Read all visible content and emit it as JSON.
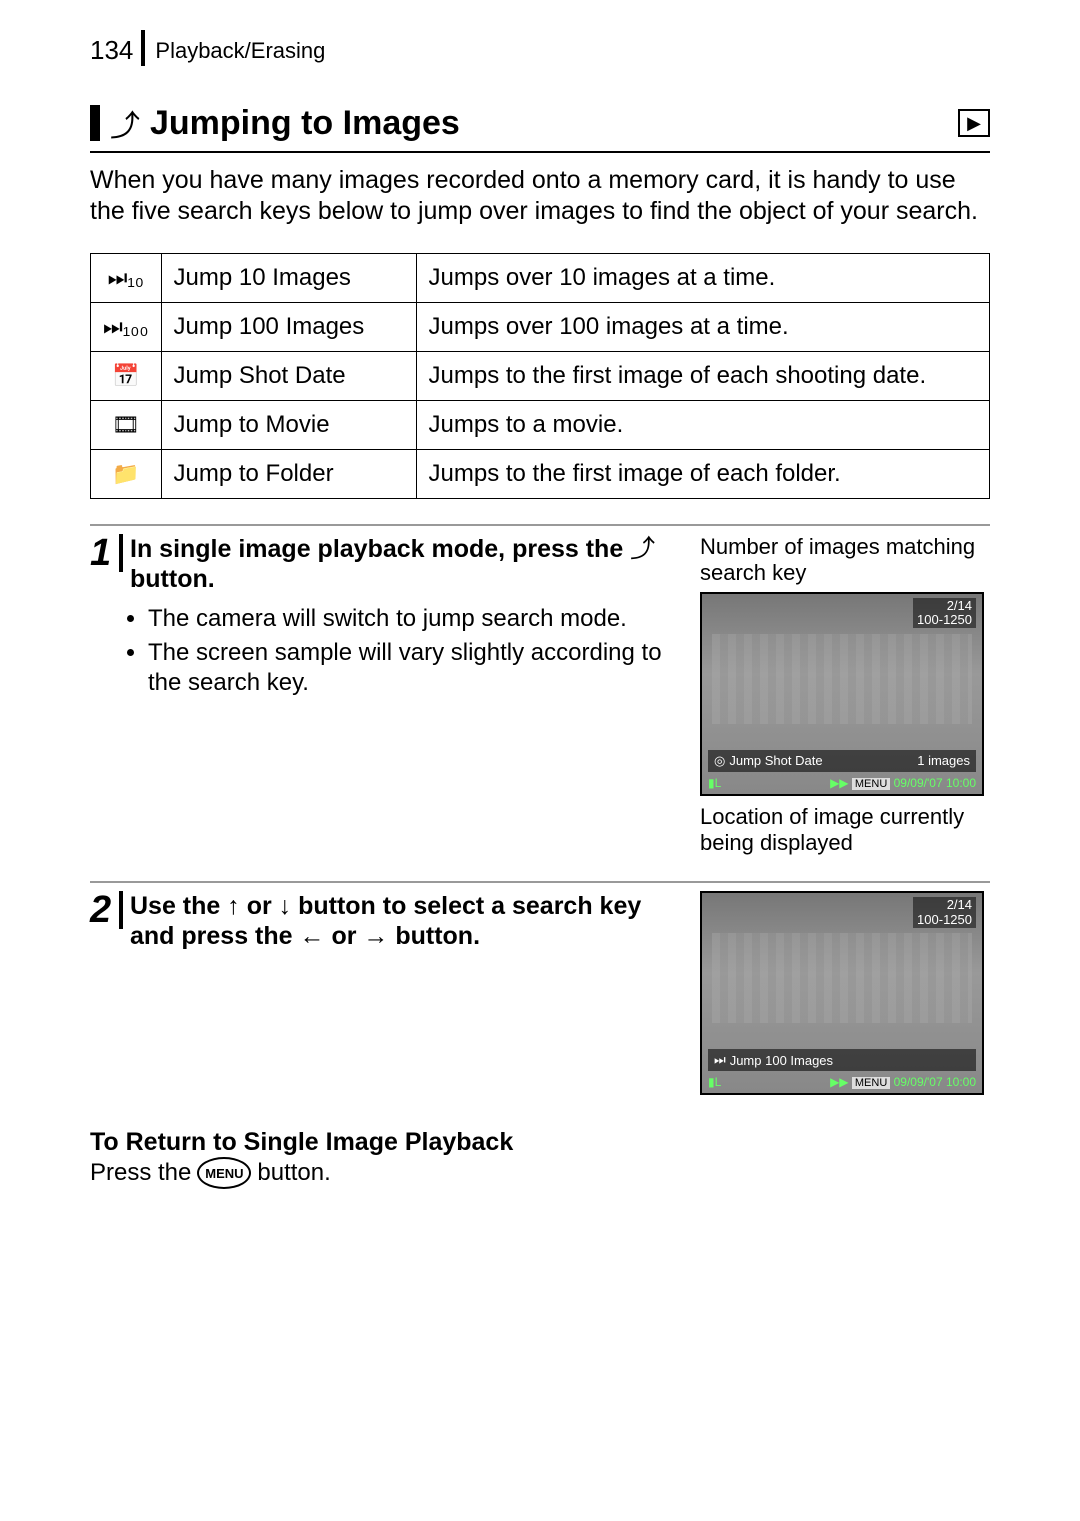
{
  "page_number": "134",
  "section": "Playback/Erasing",
  "title": "Jumping to Images",
  "intro": "When you have many images recorded onto a memory card, it is handy to use the five search keys below to jump over images to find the object of your search.",
  "table": [
    {
      "icon": "⏭₁₀",
      "label": "Jump 10 Images",
      "desc": "Jumps over 10 images at a time."
    },
    {
      "icon": "⏭₁₀₀",
      "label": "Jump 100 Images",
      "desc": "Jumps over 100 images at a time."
    },
    {
      "icon": "📅",
      "label": "Jump Shot Date",
      "desc": "Jumps to the first image of each shooting date."
    },
    {
      "icon": "🎞",
      "label": "Jump to Movie",
      "desc": "Jumps to a movie."
    },
    {
      "icon": "📁",
      "label": "Jump to Folder",
      "desc": "Jumps to the first image of each folder."
    }
  ],
  "step1": {
    "num": "1",
    "heading_a": "In single image playback mode, press the ",
    "heading_b": " button.",
    "bullets": [
      "The camera will switch to jump search mode.",
      "The screen sample will vary slightly according to the search key."
    ],
    "caption_top": "Number of images matching search key",
    "caption_bottom": "Location of image currently being displayed",
    "lcd": {
      "counter": "2/14",
      "folder": "100-1250",
      "mode": "Jump Shot Date",
      "right": "1 images",
      "menu": "MENU",
      "date": "09/09/'07",
      "time": "10:00"
    }
  },
  "step2": {
    "num": "2",
    "heading": "Use the ↑ or ↓ button to select a search key and press the ← or → button.",
    "lcd": {
      "counter": "2/14",
      "folder": "100-1250",
      "mode": "Jump 100 Images",
      "menu": "MENU",
      "date": "09/09/'07",
      "time": "10:00"
    }
  },
  "footer": {
    "heading": "To Return to Single Image Playback",
    "text_a": "Press the ",
    "btn": "MENU",
    "text_b": " button."
  }
}
